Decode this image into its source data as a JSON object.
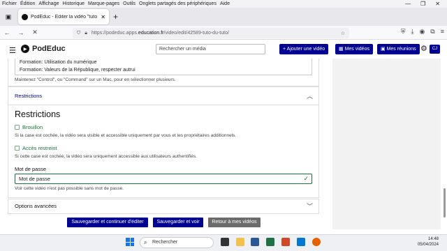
{
  "menubar": [
    "Fichier",
    "Édition",
    "Affichage",
    "Historique",
    "Marque-pages",
    "Outils",
    "Onglets partagés des périphériques",
    "Aide"
  ],
  "tab": {
    "title": "PodEduc - Éditer la vidéo \"tuto"
  },
  "url": {
    "prefix": "https://podeduc.apps.",
    "domain": "education.fr",
    "path": "/video/edit/42589-tuto-du-tuto/"
  },
  "header": {
    "brand": "PodEduc",
    "search_placeholder": "Rechercher un média",
    "add_video": "+ Ajouter une vidéo",
    "my_videos": "Mes vidéos",
    "my_meetings": "Mes réunions",
    "avatar": "CJ"
  },
  "form": {
    "textarea_lines": [
      "Formation: Utilisation du numérique",
      "Formation: Valeurs de la République, respecter autrui"
    ],
    "multi_help": "Maintenez \"Control\", ou \"Command\" sur un Mac, pour en sélectionner plusieurs.",
    "restrictions_accordion": "Restrictions",
    "restrictions_heading": "Restrictions",
    "draft_label": "Brouillon",
    "draft_help": "Si la case est cochée, la vidéo sera visible et accessible uniquement par vous et les propriétaires additionnels.",
    "restricted_label": "Accès restreint",
    "restricted_help": "Si cette case est cochée, la vidéo sera uniquement accessible aux utilisateurs authentifiés.",
    "password_label": "Mot de passe",
    "password_placeholder": "Mot de passe",
    "password_help": "Voir cette vidéo n'est pas possible sans mot de passe.",
    "advanced_options": "Options avancées"
  },
  "actions": {
    "save_continue": "Sauvegarder et continuer d'éditer",
    "save_view": "Sauvegarder et voir",
    "back": "Retour à mes vidéos"
  },
  "taskbar": {
    "search": "Rechercher",
    "time": "14:48",
    "date": "05/04/2024"
  },
  "colors": {
    "primary": "#000091",
    "success": "#18753c",
    "grey_button": "#6b6b6b"
  }
}
